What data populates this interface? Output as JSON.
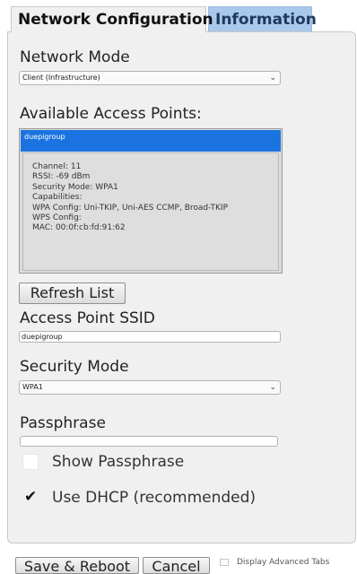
{
  "tabs": {
    "network_configuration": "Network Configuration",
    "information": "Information"
  },
  "network_mode": {
    "label": "Network Mode",
    "selected": "Client (Infrastructure)"
  },
  "access_points": {
    "label": "Available Access Points:",
    "selected_ssid": "duepigroup",
    "details": {
      "channel": "Channel: 11",
      "rssi": "RSSI: -69 dBm",
      "security_mode": "Security Mode: WPA1",
      "capabilities": "Capabilities:",
      "wpa_config": "WPA Config: Uni-TKIP, Uni-AES CCMP, Broad-TKIP",
      "wps_config": "WPS Config:",
      "mac": "MAC: 00:0f:cb:fd:91:62"
    },
    "refresh_label": "Refresh List"
  },
  "ssid": {
    "label": "Access Point SSID",
    "value": "duepigroup"
  },
  "security_mode": {
    "label": "Security Mode",
    "selected": "WPA1"
  },
  "passphrase": {
    "label": "Passphrase",
    "value": ""
  },
  "show_passphrase": {
    "label": "Show Passphrase",
    "checked": false
  },
  "use_dhcp": {
    "label": "Use DHCP (recommended)",
    "checked": true,
    "check_glyph": "✔"
  },
  "footer": {
    "save_reboot_label": "Save & Reboot",
    "cancel_label": "Cancel",
    "display_advanced_tabs_label": "Display Advanced Tabs",
    "display_advanced_tabs_checked": false
  },
  "icons": {
    "dropdown": "chevron-down-icon",
    "check": "checkmark-icon"
  },
  "colors": {
    "panel_bg": "#f0f0f0",
    "inactive_tab_bg": "#aac8ea",
    "selection_blue": "#1a73e0"
  }
}
